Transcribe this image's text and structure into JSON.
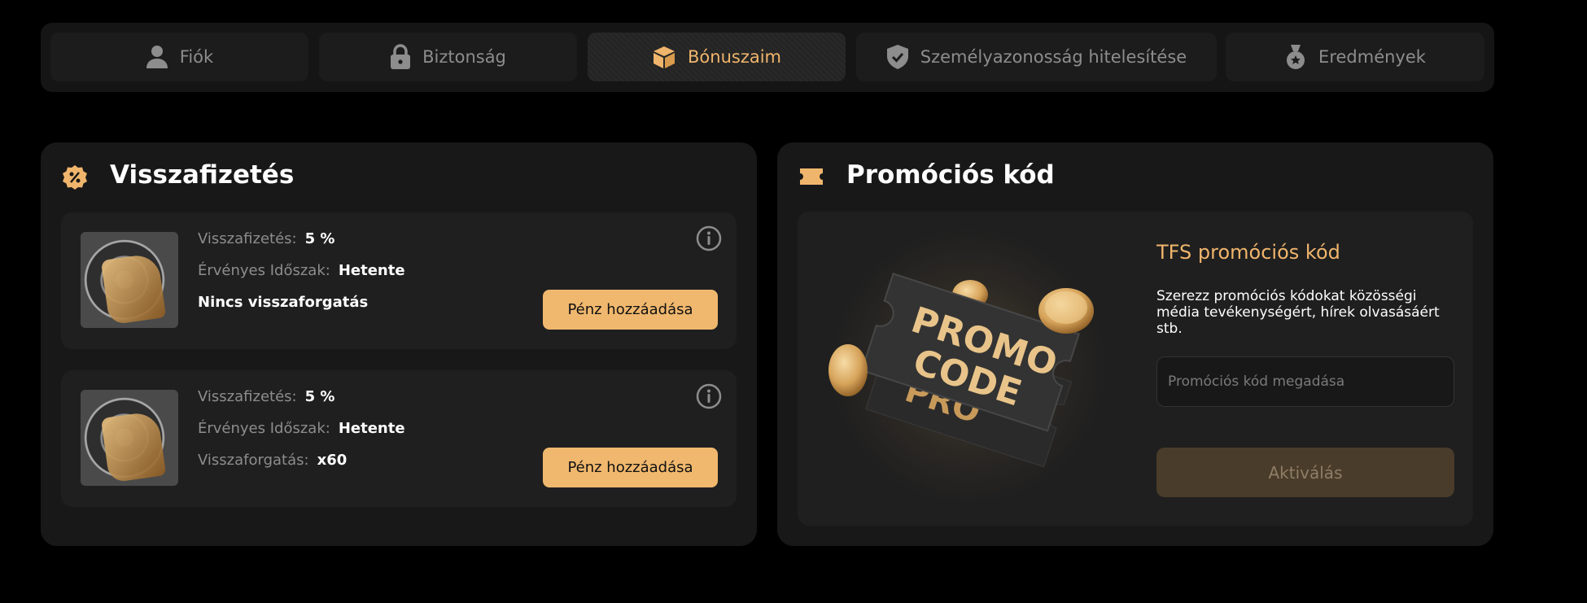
{
  "tabs": [
    {
      "label": "Fiók",
      "icon": "user-icon",
      "active": false
    },
    {
      "label": "Biztonság",
      "icon": "lock-icon",
      "active": false
    },
    {
      "label": "Bónuszaim",
      "icon": "box-icon",
      "active": true
    },
    {
      "label": "Személyazonosság hitelesítése",
      "icon": "shield-check-icon",
      "active": false
    },
    {
      "label": "Eredmények",
      "icon": "medal-icon",
      "active": false
    }
  ],
  "cashback": {
    "title": "Visszafizetés",
    "icon": "percent-badge-icon",
    "items": [
      {
        "rate_label": "Visszafizetés:",
        "rate_value": "5 %",
        "period_label": "Érvényes Időszak:",
        "period_value": "Hetente",
        "wager_text": "Nincs visszaforgatás",
        "button_label": "Pénz hozzáadása"
      },
      {
        "rate_label": "Visszafizetés:",
        "rate_value": "5 %",
        "period_label": "Érvényes Időszak:",
        "period_value": "Hetente",
        "wager_label": "Visszaforgatás:",
        "wager_value": "x60",
        "button_label": "Pénz hozzáadása"
      }
    ]
  },
  "promo": {
    "title": "Promóciós kód",
    "icon": "ticket-icon",
    "heading": "TFS promóciós kód",
    "description": "Szerezz promóciós kódokat közösségi média tevékenységért, hírek olvasásáért stb.",
    "input_placeholder": "Promóciós kód megadása",
    "activate_label": "Aktiválás",
    "image_text_line1": "PROMO",
    "image_text_line2": "CODE"
  },
  "colors": {
    "accent": "#f0b86e",
    "background": "#000000",
    "card": "#181818",
    "inner": "#1f1f1f"
  }
}
